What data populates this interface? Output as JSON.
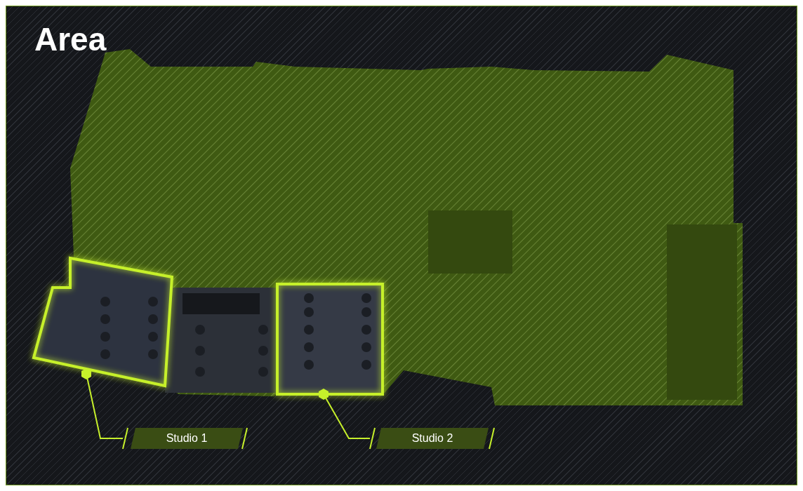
{
  "title": "Area",
  "labels": [
    {
      "text": "Studio 1"
    },
    {
      "text": "Studio 2"
    }
  ]
}
